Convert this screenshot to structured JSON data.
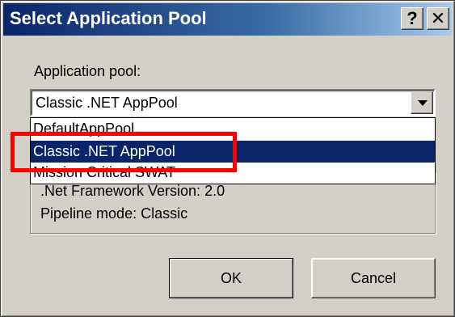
{
  "window": {
    "title": "Select Application Pool",
    "help_glyph": "?",
    "close_glyph": "✕"
  },
  "form": {
    "pool_label": "Application pool:",
    "selected_value": "Classic .NET AppPool"
  },
  "dropdown": {
    "options": [
      "DefaultAppPool",
      "Classic .NET AppPool",
      "Mission Critical SWAT"
    ],
    "highlighted_index": 1
  },
  "details": {
    "framework": ".Net Framework Version: 2.0",
    "pipeline": "Pipeline mode: Classic"
  },
  "buttons": {
    "ok": "OK",
    "cancel": "Cancel"
  },
  "annotation": {
    "highlight_color": "#ff0000"
  },
  "theme": {
    "titlebar_color": "#0a246a",
    "selection_color": "#0a246a",
    "face_color": "#d4d0c8"
  }
}
